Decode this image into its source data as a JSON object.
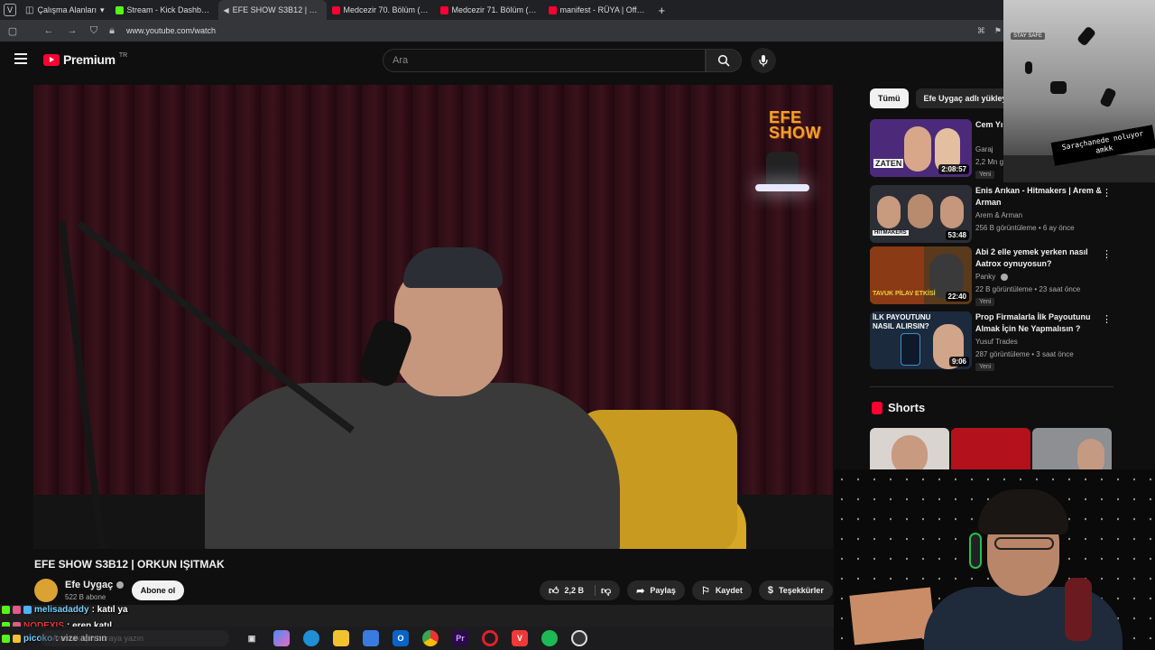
{
  "browser": {
    "tabs": [
      {
        "label": "Çalışma Alanları",
        "kind": "workspace"
      },
      {
        "label": "Stream - Kick Dashboard",
        "kind": "kick"
      },
      {
        "label": "EFE SHOW S3B12 | ORKUN",
        "kind": "vol",
        "active": true
      },
      {
        "label": "Medcezir 70. Bölüm (4K) - ",
        "kind": "yt"
      },
      {
        "label": "Medcezir 71. Bölüm (4K) - ",
        "kind": "yt"
      },
      {
        "label": "manifest - RÜYA | Official M",
        "kind": "yt"
      }
    ],
    "new_tab": "+",
    "url": "www.youtube.com/watch"
  },
  "youtube": {
    "logo_word": "Premium",
    "country": "TR",
    "search_placeholder": "Ara"
  },
  "video": {
    "overlay_logo_line1": "EFE",
    "overlay_logo_line2": "SHOW",
    "title": "EFE SHOW S3B12 | ORKUN IŞITMAK",
    "channel": "Efe Uygaç",
    "subscribers": "522 B abone",
    "subscribe_label": "Abone ol",
    "likes": "2,2 B",
    "share_label": "Paylaş",
    "save_label": "Kaydet",
    "thanks_label": "Teşekkürler"
  },
  "sidebar": {
    "chips": [
      "Tümü",
      "Efe Uygaç adlı yükleyic"
    ],
    "recommendations": [
      {
        "title": "Cem Yı... Zaten S...",
        "channel": "Garaj",
        "meta": "2,2 Mn g...",
        "badge": "Yeni",
        "duration": "2:08:57",
        "thumb_text": "ZATEN",
        "color": "#4b2a7a"
      },
      {
        "title": "Enis Arıkan - Hitmakers | Arem & Arman",
        "channel": "Arem & Arman",
        "meta": "256 B görüntüleme • 6 ay önce",
        "badge": "",
        "duration": "53:48",
        "thumb_text": "HITMAKERS",
        "color": "#2b2e35"
      },
      {
        "title": "Abi 2 elle yemek yerken nasıl Aatrox oynuyosun?",
        "channel": "Panky",
        "meta": "22 B görüntüleme • 23 saat önce",
        "badge": "Yeni",
        "duration": "22:40",
        "thumb_text": "TAVUK PİLAV ETKİSİ",
        "color": "#5a3a1c"
      },
      {
        "title": "Prop Firmalarla İlk Payoutunu Almak İçin Ne Yapmalısın ?",
        "channel": "Yusuf Trades",
        "meta": "287 görüntüleme • 3 saat önce",
        "badge": "Yeni",
        "duration": "9:06",
        "thumb_text": "İLK PAYOUTUNU NASIL ALIRSIN?",
        "color": "#1b2a3c"
      }
    ],
    "shorts_title": "Shorts"
  },
  "overlay_top": {
    "stay_safe": "STAY SAFE",
    "caption": "Saraçhanede noluyor amkk"
  },
  "chat": [
    {
      "user": "melisadaddy",
      "msg": ": katıl ya",
      "red": false
    },
    {
      "user": "NODEXIS",
      "msg": ": eren katıl",
      "red": true
    },
    {
      "user": "picoko",
      "msg": ": vize alırsın",
      "red": false
    }
  ],
  "taskbar": {
    "search_placeholder": "Aramak için buraya yazın",
    "apps": [
      "task-view",
      "copilot",
      "edge",
      "explorer",
      "store",
      "outlook",
      "chrome",
      "premiere",
      "opera",
      "vivaldi",
      "spotify",
      "obs"
    ]
  }
}
